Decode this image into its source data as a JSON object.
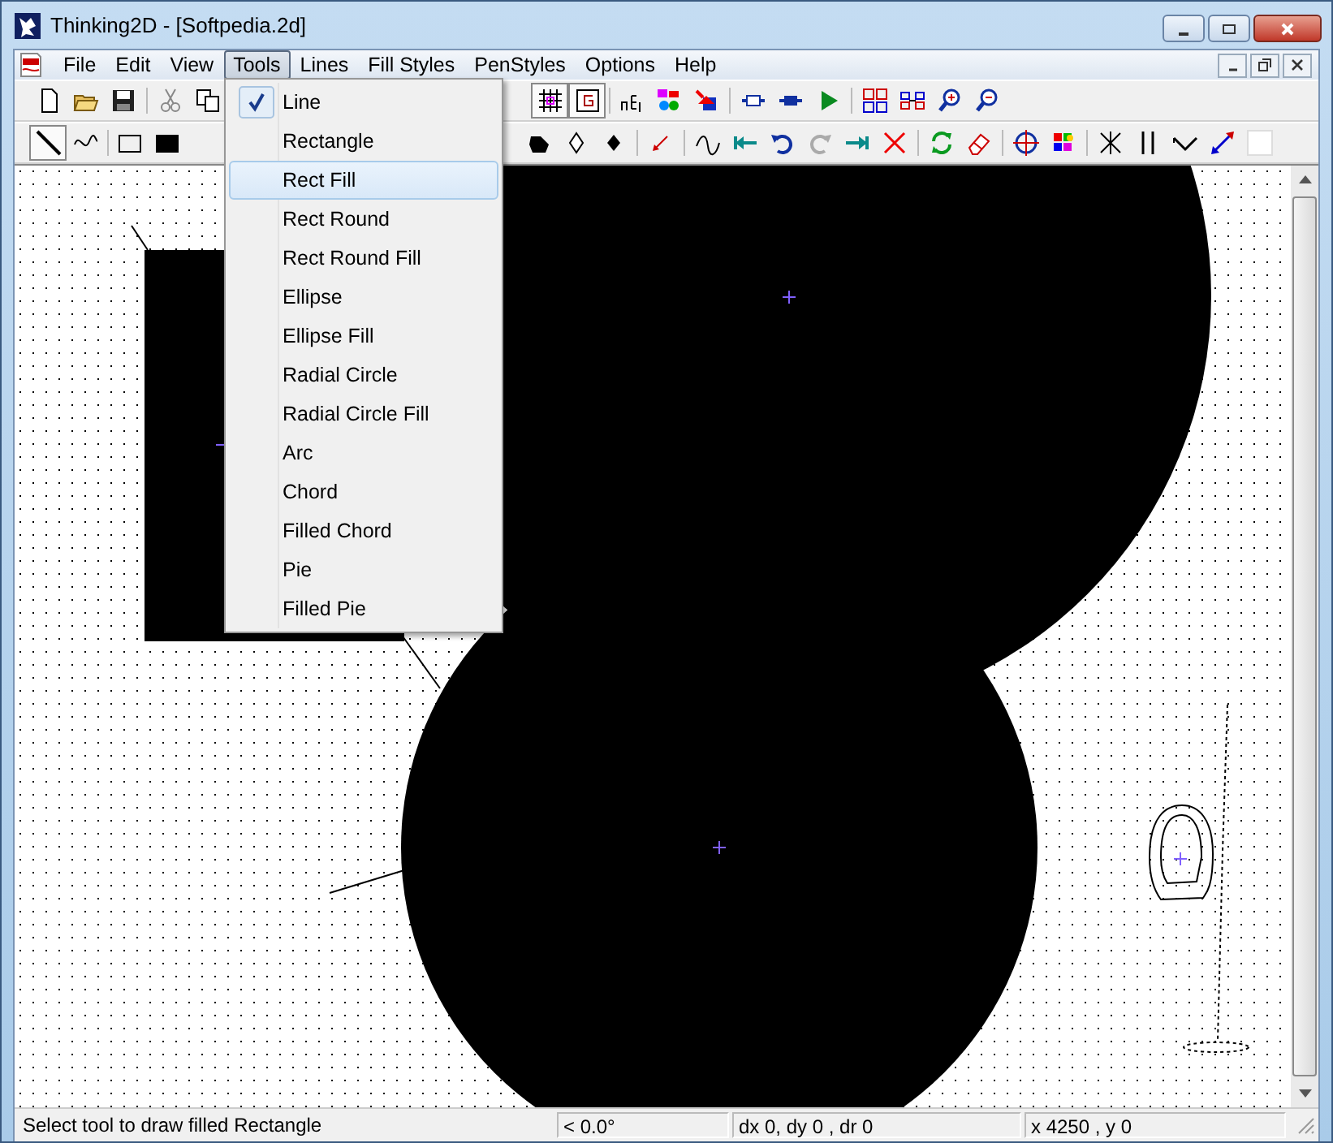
{
  "window": {
    "title": "Thinking2D - [Softpedia.2d]"
  },
  "menu_bar": [
    {
      "label": "File",
      "selected": false
    },
    {
      "label": "Edit",
      "selected": false
    },
    {
      "label": "View",
      "selected": false
    },
    {
      "label": "Tools",
      "selected": true
    },
    {
      "label": "Lines",
      "selected": false
    },
    {
      "label": "Fill Styles",
      "selected": false
    },
    {
      "label": "PenStyles",
      "selected": false
    },
    {
      "label": "Options",
      "selected": false
    },
    {
      "label": "Help",
      "selected": false
    }
  ],
  "tools_menu": [
    {
      "label": "Line",
      "checked": true,
      "selected": false
    },
    {
      "label": "Rectangle",
      "checked": false,
      "selected": false
    },
    {
      "label": "Rect Fill",
      "checked": false,
      "selected": true
    },
    {
      "label": "Rect Round",
      "checked": false,
      "selected": false
    },
    {
      "label": "Rect Round Fill",
      "checked": false,
      "selected": false
    },
    {
      "label": "Ellipse",
      "checked": false,
      "selected": false
    },
    {
      "label": "Ellipse Fill",
      "checked": false,
      "selected": false
    },
    {
      "label": "Radial Circle",
      "checked": false,
      "selected": false
    },
    {
      "label": "Radial Circle Fill",
      "checked": false,
      "selected": false
    },
    {
      "label": "Arc",
      "checked": false,
      "selected": false
    },
    {
      "label": "Chord",
      "checked": false,
      "selected": false
    },
    {
      "label": "Filled Chord",
      "checked": false,
      "selected": false
    },
    {
      "label": "Pie",
      "checked": false,
      "selected": false
    },
    {
      "label": "Filled Pie",
      "checked": false,
      "selected": false
    }
  ],
  "status_bar": {
    "message": "Select tool to draw filled Rectangle",
    "angle": "< 0.0°",
    "delta": "dx  0, dy 0 , dr 0",
    "position": "x  4250 , y  0"
  }
}
